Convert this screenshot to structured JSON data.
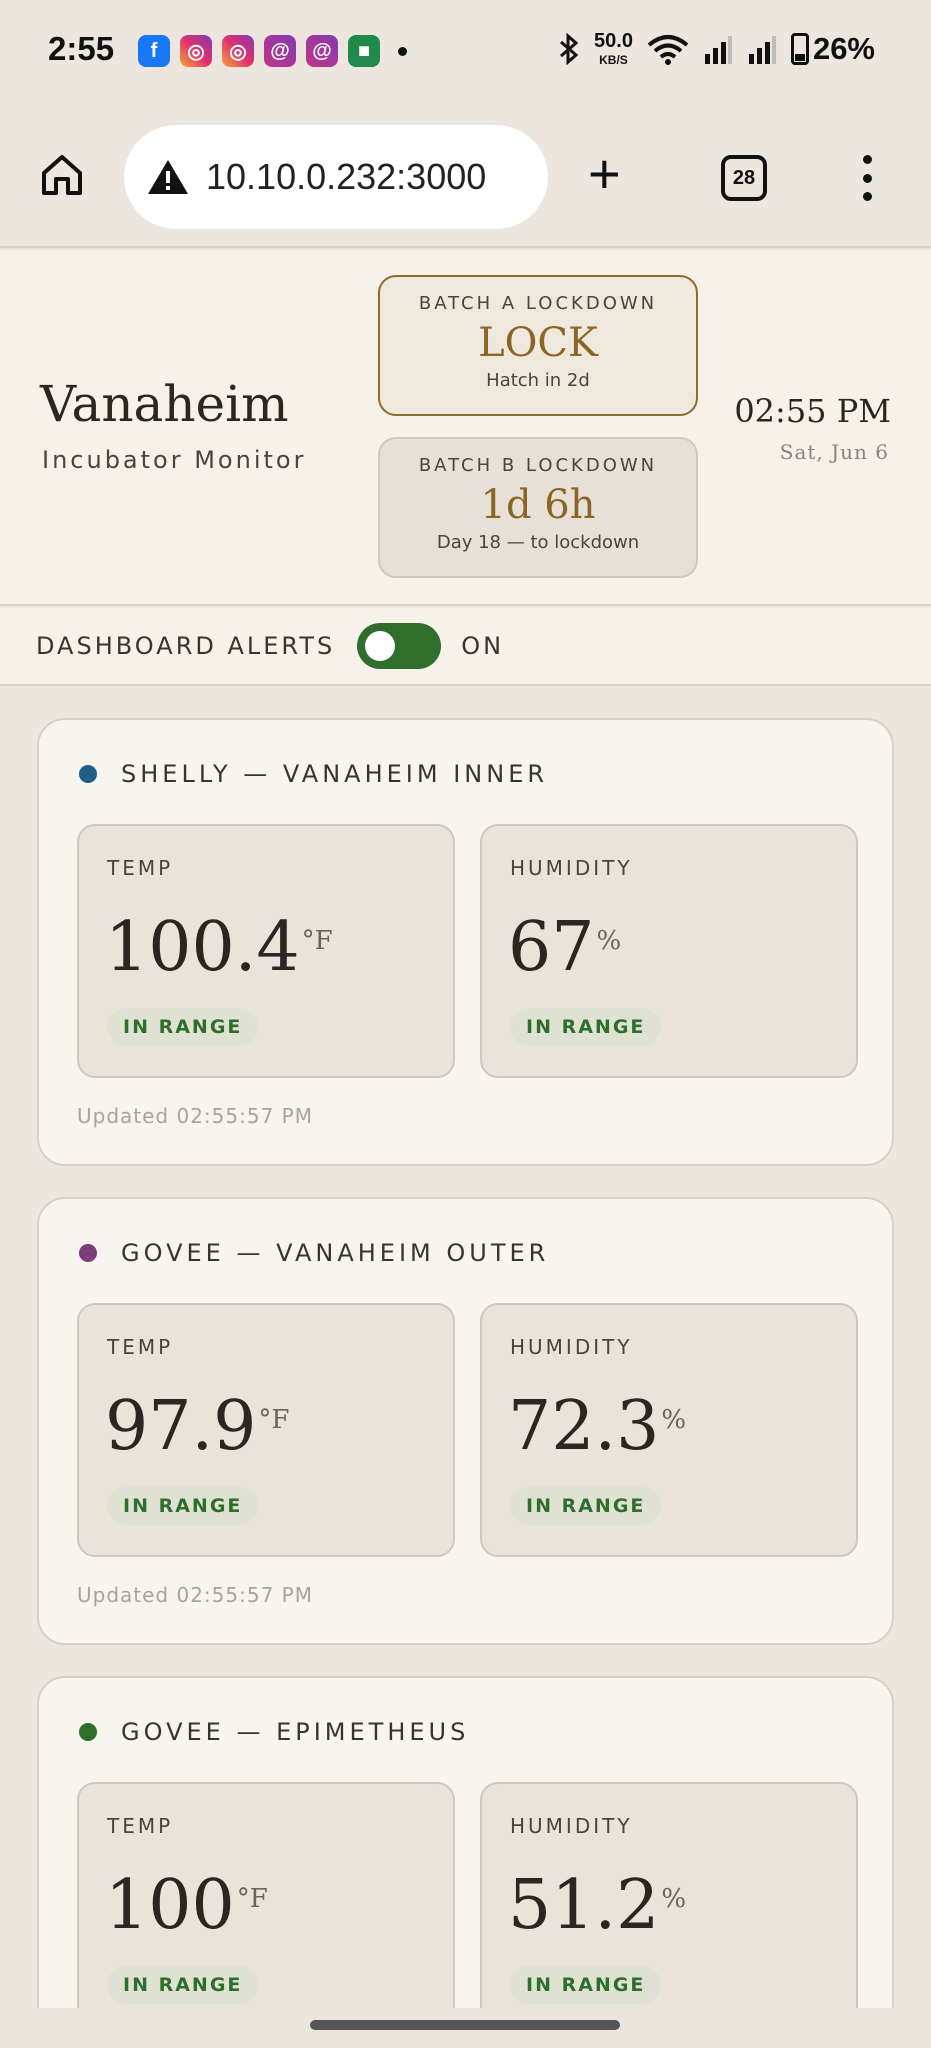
{
  "status_bar": {
    "time": "2:55",
    "app_icons": [
      "facebook-icon",
      "instagram-icon",
      "instagram-icon",
      "threads-icon",
      "threads-icon",
      "app-icon"
    ],
    "net_speed_value": "50.0",
    "net_speed_unit": "KB/S",
    "battery": "26%"
  },
  "browser": {
    "url": "10.10.0.232:3000",
    "tab_count": "28",
    "new_tab": "+"
  },
  "header": {
    "title": "Vanaheim",
    "subtitle": "Incubator Monitor",
    "batch_a": {
      "label": "BATCH A LOCKDOWN",
      "value": "LOCK",
      "note": "Hatch in 2d"
    },
    "batch_b": {
      "label": "BATCH B LOCKDOWN",
      "value": "1d 6h",
      "note": "Day 18 — to lockdown"
    },
    "time": "02:55 PM",
    "date": "Sat, Jun 6"
  },
  "alerts": {
    "label": "DASHBOARD ALERTS",
    "state": "ON",
    "enabled": true
  },
  "colors": {
    "accent_green": "#2f6e2d",
    "gold": "#8a6526",
    "sensor1": "#1f5f86",
    "sensor2": "#7a3f7a",
    "sensor3": "#2f6e2d"
  },
  "sensors": [
    {
      "name": "SHELLY — VANAHEIM INNER",
      "temp_label": "TEMP",
      "temp_value": "100.4",
      "temp_unit": "°F",
      "temp_status": "IN RANGE",
      "hum_label": "HUMIDITY",
      "hum_value": "67",
      "hum_unit": "%",
      "hum_status": "IN RANGE",
      "updated": "Updated 02:55:57 PM"
    },
    {
      "name": "GOVEE — VANAHEIM OUTER",
      "temp_label": "TEMP",
      "temp_value": "97.9",
      "temp_unit": "°F",
      "temp_status": "IN RANGE",
      "hum_label": "HUMIDITY",
      "hum_value": "72.3",
      "hum_unit": "%",
      "hum_status": "IN RANGE",
      "updated": "Updated 02:55:57 PM"
    },
    {
      "name": "GOVEE — EPIMETHEUS",
      "temp_label": "TEMP",
      "temp_value": "100",
      "temp_unit": "°F",
      "temp_status": "IN RANGE",
      "hum_label": "HUMIDITY",
      "hum_value": "51.2",
      "hum_unit": "%",
      "hum_status": "IN RANGE"
    }
  ]
}
